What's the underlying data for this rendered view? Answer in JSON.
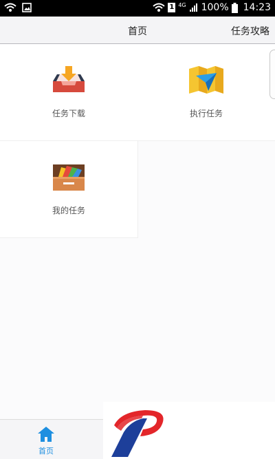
{
  "status_bar": {
    "battery_percent": "100%",
    "time": "14:23",
    "network": "4G",
    "sim_slot": "1",
    "icons": [
      "wifi-icon",
      "image-icon",
      "wifi-icon",
      "sim-icon",
      "signal-icon",
      "battery-icon"
    ]
  },
  "header": {
    "title": "首页",
    "right_link": "任务攻略"
  },
  "tiles": [
    {
      "label": "任务下载",
      "icon": "download-tray-icon"
    },
    {
      "label": "执行任务",
      "icon": "map-navigation-icon"
    },
    {
      "label": "我的任务",
      "icon": "task-drawer-icon"
    }
  ],
  "bottom_nav": {
    "items": [
      {
        "label": "首页",
        "icon": "home-icon",
        "active": true
      }
    ],
    "active_color": "#1e8fe0"
  },
  "colors": {
    "status_bar_bg": "#000000",
    "header_bg": "#f4f4f6",
    "page_bg": "#fbfbfc",
    "accent_blue": "#1e8fe0",
    "logo_red": "#e3262a",
    "logo_blue": "#1d3f9a"
  }
}
